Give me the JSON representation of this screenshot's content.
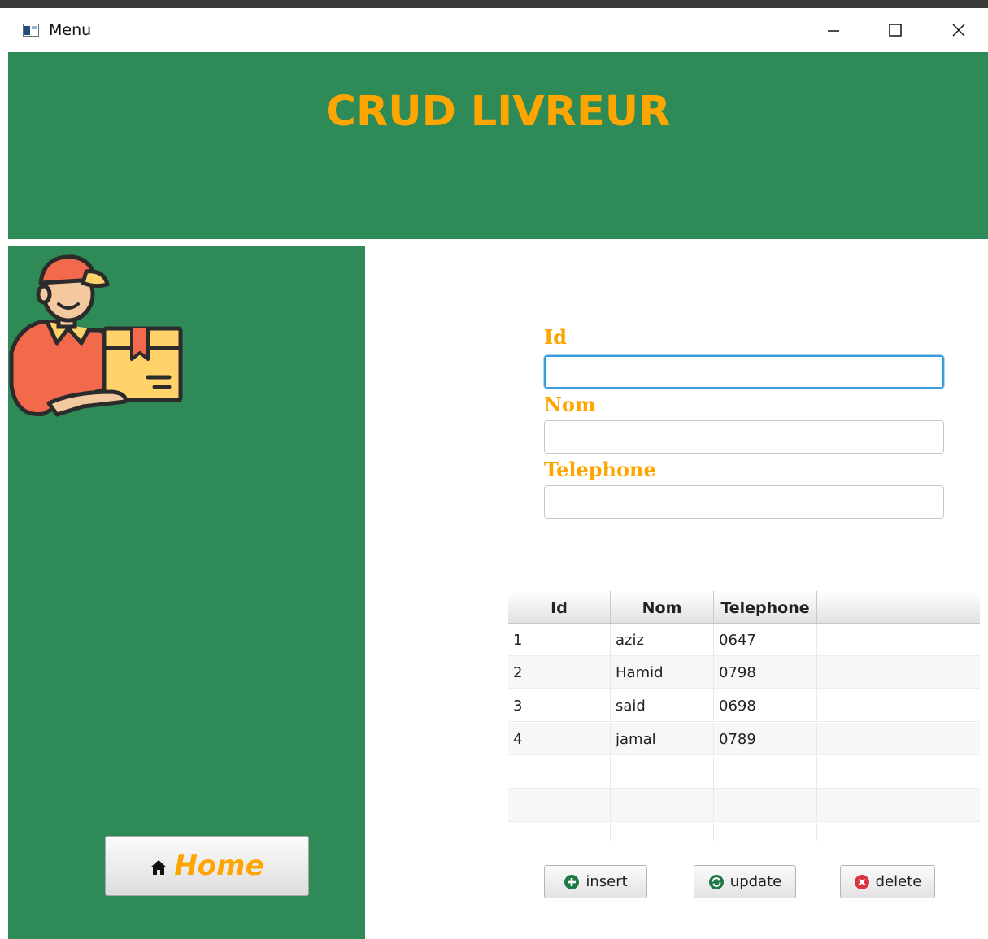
{
  "window": {
    "title": "Menu"
  },
  "header": {
    "title": "CRUD LIVREUR"
  },
  "sidebar": {
    "home_label": "Home",
    "illustration": "delivery-man-icon"
  },
  "form": {
    "id_label": "Id",
    "id_value": "",
    "nom_label": "Nom",
    "nom_value": "",
    "telephone_label": "Telephone",
    "telephone_value": ""
  },
  "table": {
    "columns": [
      "Id",
      "Nom",
      "Telephone"
    ],
    "rows": [
      {
        "id": "1",
        "nom": "aziz",
        "telephone": "0647"
      },
      {
        "id": "2",
        "nom": "Hamid",
        "telephone": "0798"
      },
      {
        "id": "3",
        "nom": "said",
        "telephone": "0698"
      },
      {
        "id": "4",
        "nom": "jamal",
        "telephone": "0789"
      }
    ]
  },
  "buttons": {
    "insert": "insert",
    "update": "update",
    "delete": "delete"
  },
  "colors": {
    "header_bg": "#2e8b57",
    "accent": "#ffa500",
    "focus": "#3a9bdc"
  }
}
